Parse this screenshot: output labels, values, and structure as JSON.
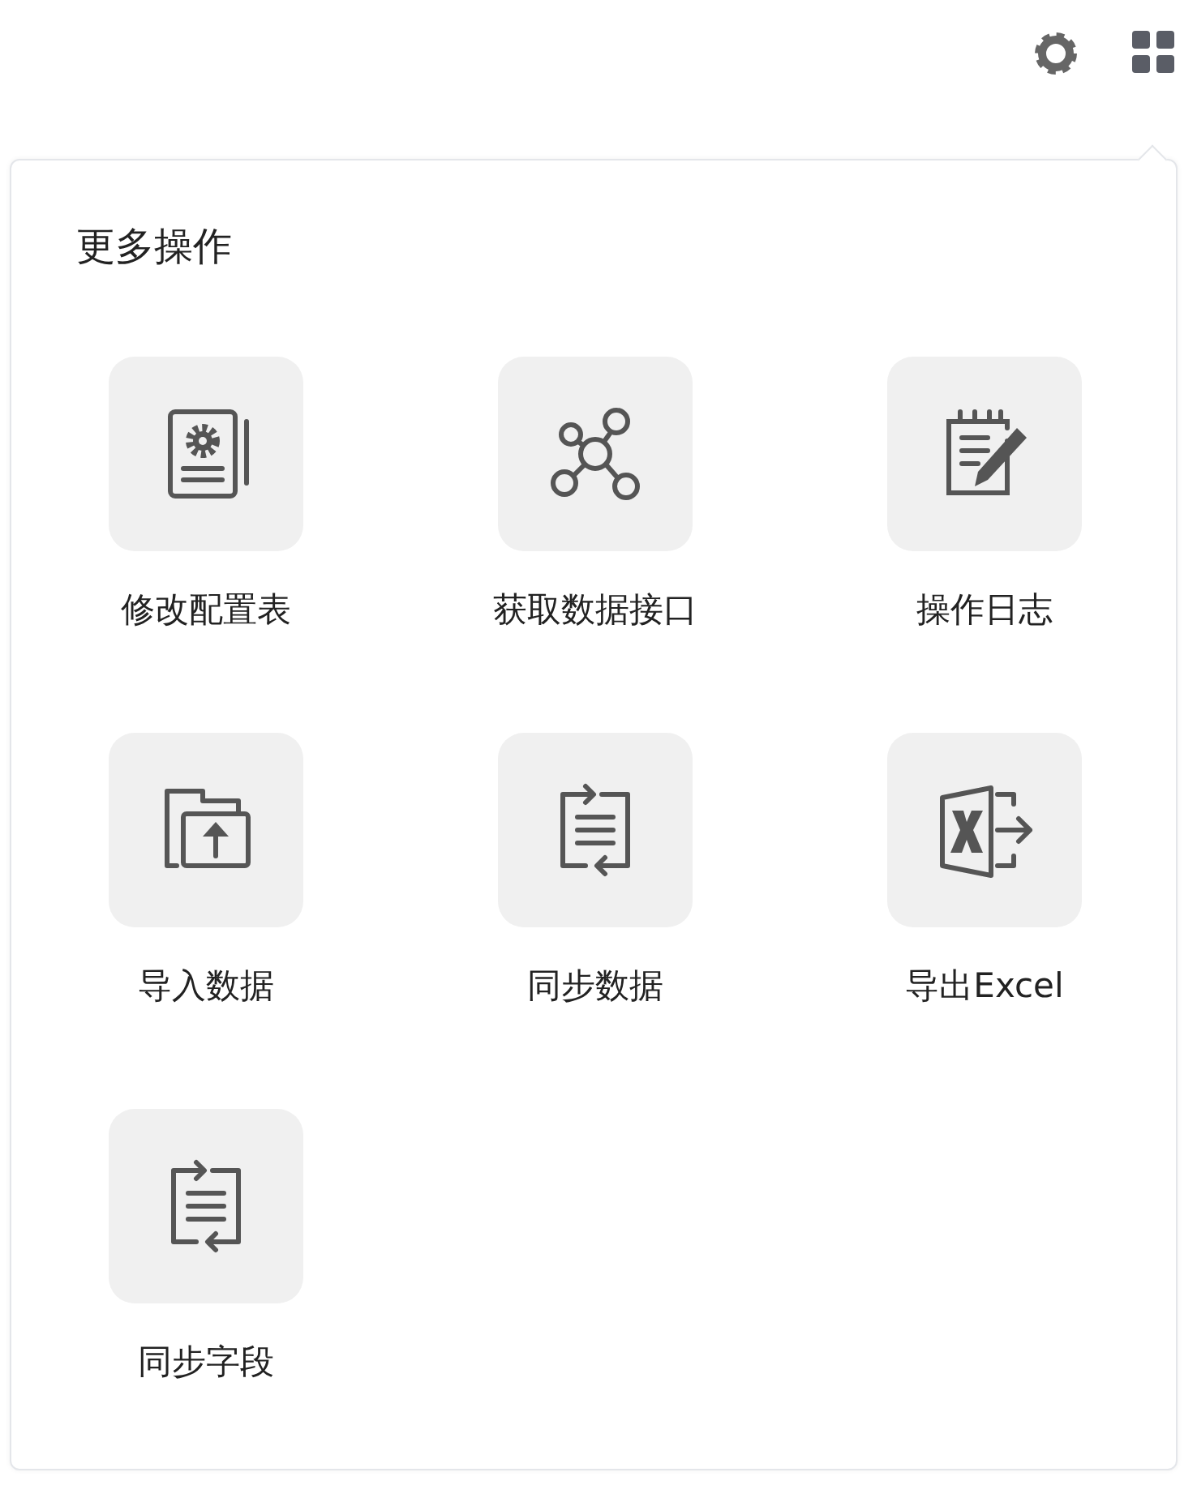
{
  "popover": {
    "title": "更多操作",
    "actions": [
      {
        "label": "修改配置表",
        "kind": "config"
      },
      {
        "label": "获取数据接口",
        "kind": "network"
      },
      {
        "label": "操作日志",
        "kind": "log"
      },
      {
        "label": "导入数据",
        "kind": "import"
      },
      {
        "label": "同步数据",
        "kind": "sync"
      },
      {
        "label": "导出Excel",
        "kind": "excel"
      },
      {
        "label": "同步字段",
        "kind": "sync"
      }
    ]
  }
}
